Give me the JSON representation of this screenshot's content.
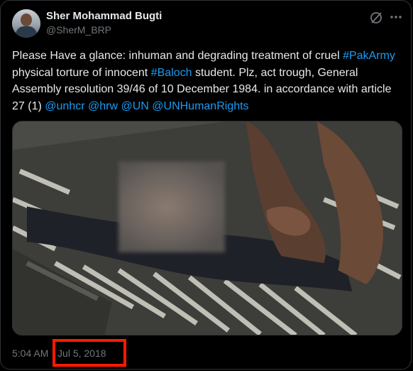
{
  "author": {
    "name": "Sher Mohammad Bugti",
    "handle": "@SherM_BRP"
  },
  "icons": {
    "avatar": "profile-photo",
    "platform": "x-logo-icon",
    "more": "more-options-icon"
  },
  "tweet": {
    "text_1": "Please Have a glance: inhuman and degrading treatment of cruel ",
    "hashtag_1": "#PakArmy",
    "text_2": " physical torture of innocent ",
    "hashtag_2": "#Baloch",
    "text_3": " student. Plz, act trough, General Assembly resolution 39/46 of 10 December 1984. in accordance with article 27 (1) ",
    "mention_1": "@unhcr",
    "mention_2": "@hrw",
    "mention_3": "@UN",
    "mention_4": "@UNHumanRights"
  },
  "meta": {
    "time": "5:04 AM",
    "separator": "·",
    "date": "Jul 5, 2018"
  },
  "colors": {
    "background": "#000000",
    "text": "#e7e9ea",
    "muted": "#71767b",
    "link": "#1d9bf0",
    "highlight": "#ff1a00"
  }
}
